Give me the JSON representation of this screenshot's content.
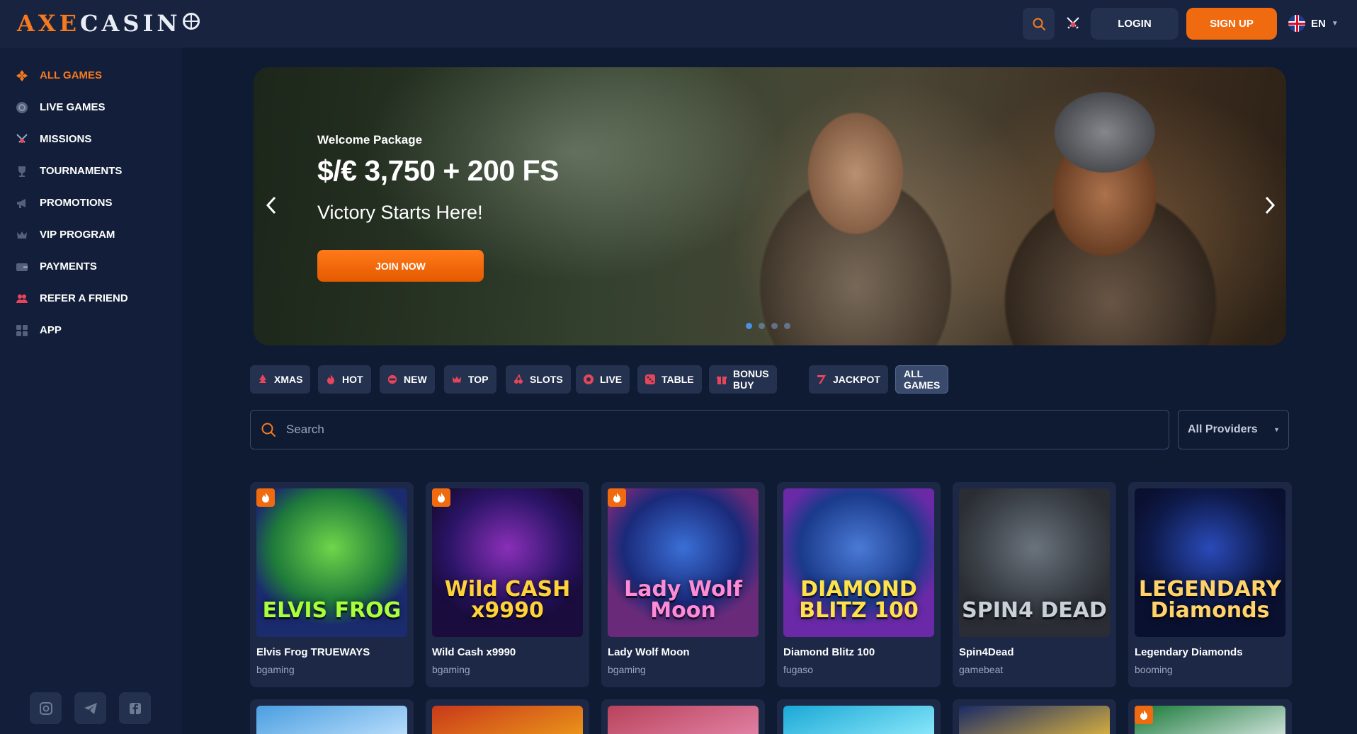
{
  "brand": {
    "logo_axe": "AXE",
    "logo_casino": "CASIN"
  },
  "header": {
    "login": "LOGIN",
    "signup": "SIGN UP",
    "language": "EN"
  },
  "sidebar": {
    "items": [
      {
        "label": "ALL GAMES",
        "icon": "all-games-icon",
        "active": true
      },
      {
        "label": "LIVE GAMES",
        "icon": "live-games-icon"
      },
      {
        "label": "MISSIONS",
        "icon": "missions-icon"
      },
      {
        "label": "TOURNAMENTS",
        "icon": "trophy-icon"
      },
      {
        "label": "PROMOTIONS",
        "icon": "megaphone-icon"
      },
      {
        "label": "VIP PROGRAM",
        "icon": "crown-icon"
      },
      {
        "label": "PAYMENTS",
        "icon": "wallet-icon"
      },
      {
        "label": "REFER A FRIEND",
        "icon": "users-icon"
      },
      {
        "label": "APP",
        "icon": "app-grid-icon"
      }
    ],
    "socials": [
      "instagram-icon",
      "telegram-icon",
      "facebook-icon"
    ]
  },
  "banner": {
    "kicker": "Welcome Package",
    "title": "$/€ 3,750 + 200 FS",
    "subtitle": "Victory Starts Here!",
    "cta": "JOIN NOW",
    "slides": 4,
    "active_slide": 1
  },
  "categories": [
    {
      "label": "XMAS",
      "icon": "tree-icon"
    },
    {
      "label": "HOT",
      "icon": "flame-icon"
    },
    {
      "label": "NEW",
      "icon": "new-badge-icon"
    },
    {
      "label": "TOP",
      "icon": "crown-icon"
    },
    {
      "label": "SLOTS",
      "icon": "cherry-icon"
    },
    {
      "label": "LIVE",
      "icon": "live-icon"
    },
    {
      "label": "TABLE",
      "icon": "dice-icon"
    },
    {
      "label": "BONUS BUY",
      "icon": "gift-icon"
    },
    {
      "label": "JACKPOT",
      "icon": "seven-icon"
    },
    {
      "label": "ALL GAMES",
      "icon": "",
      "selected": true
    }
  ],
  "search": {
    "placeholder": "Search",
    "providers": "All Providers"
  },
  "games": [
    {
      "name": "Elvis Frog TRUEWAYS",
      "provider": "bgaming",
      "hot": true,
      "art": "ELVIS FROG",
      "colors": [
        "#1e7a3a",
        "#6fd64a",
        "#1a2b6e"
      ],
      "art_color": "#a8ff3a"
    },
    {
      "name": "Wild Cash x9990",
      "provider": "bgaming",
      "hot": true,
      "art": "Wild CASH x9990",
      "colors": [
        "#2a1466",
        "#8a2fb8",
        "#1a0c3d"
      ],
      "art_color": "#ffd23a"
    },
    {
      "name": "Lady Wolf Moon",
      "provider": "bgaming",
      "hot": true,
      "art": "Lady Wolf Moon",
      "colors": [
        "#1a2a7a",
        "#3a6fd6",
        "#6a2a7a"
      ],
      "art_color": "#ff8ad8"
    },
    {
      "name": "Diamond Blitz 100",
      "provider": "fugaso",
      "hot": false,
      "art": "DIAMOND BLITZ 100",
      "colors": [
        "#1a3a8a",
        "#4a7ad6",
        "#6a2aa8"
      ],
      "art_color": "#ffe14a"
    },
    {
      "name": "Spin4Dead",
      "provider": "gamebeat",
      "hot": false,
      "art": "SPIN4 DEAD",
      "colors": [
        "#3a3f46",
        "#6a737d",
        "#2a2d33"
      ],
      "art_color": "#c8d0d8"
    },
    {
      "name": "Legendary Diamonds",
      "provider": "booming",
      "hot": false,
      "art": "LEGENDARY Diamonds",
      "colors": [
        "#0e1a4a",
        "#2a4ab8",
        "#0a1030"
      ],
      "art_color": "#ffd36a"
    }
  ],
  "games_row2": [
    {
      "hot": false,
      "colors": [
        "#4a9ee0",
        "#c8e6ff"
      ]
    },
    {
      "hot": false,
      "colors": [
        "#c8381a",
        "#f0a21a"
      ]
    },
    {
      "hot": false,
      "colors": [
        "#b8425a",
        "#e88ab0"
      ]
    },
    {
      "hot": false,
      "colors": [
        "#1aa8d6",
        "#9af0ff"
      ]
    },
    {
      "hot": false,
      "colors": [
        "#1a2a66",
        "#f0c23a"
      ]
    },
    {
      "hot": true,
      "colors": [
        "#1a7a3a",
        "#e8f0f0"
      ]
    }
  ]
}
